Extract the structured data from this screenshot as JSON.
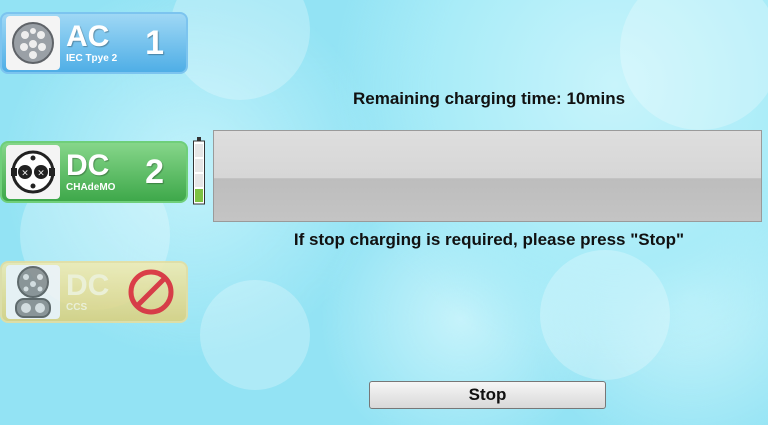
{
  "connectors": [
    {
      "type": "AC",
      "subtype": "IEC Tpye 2",
      "number": "1",
      "color": "#4faee6"
    },
    {
      "type": "DC",
      "subtype": "CHAdeMO",
      "number": "2",
      "color": "#3ea84a"
    },
    {
      "type": "DC",
      "subtype": "CCS",
      "status_icon": "prohibited-icon",
      "color": "#ddd07a"
    }
  ],
  "charging": {
    "remaining_label": "Remaining charging time: 10mins",
    "progress_fraction": 0.0,
    "stop_message": "If stop charging is required, please press \"Stop\""
  },
  "stop_button": {
    "label": "Stop"
  },
  "battery_icon": "battery-level-icon"
}
